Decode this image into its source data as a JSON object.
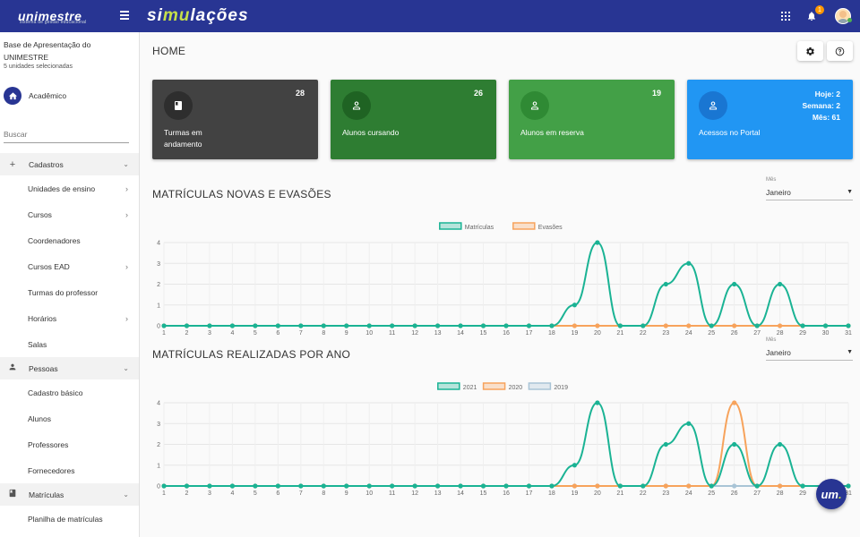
{
  "topbar": {
    "logo_text": "unimestre",
    "logo_sub": "sistema de gestão educacional",
    "brand_parts": [
      "si",
      "mu",
      "lações"
    ],
    "notification_count": "1"
  },
  "sidebar": {
    "org_name": "Base de Apresentação do UNIMESTRE",
    "units": "5 unidades selecionadas",
    "academic_label": "Acadêmico",
    "search_placeholder": "Buscar",
    "groups": [
      {
        "label": "Cadastros",
        "icon": "plus-icon",
        "items": [
          {
            "label": "Unidades de ensino",
            "has_children": true
          },
          {
            "label": "Cursos",
            "has_children": true
          },
          {
            "label": "Coordenadores",
            "has_children": false
          },
          {
            "label": "Cursos EAD",
            "has_children": true
          },
          {
            "label": "Turmas do professor",
            "has_children": false
          },
          {
            "label": "Horários",
            "has_children": true
          },
          {
            "label": "Salas",
            "has_children": false
          }
        ]
      },
      {
        "label": "Pessoas",
        "icon": "person-icon",
        "items": [
          {
            "label": "Cadastro básico",
            "has_children": false
          },
          {
            "label": "Alunos",
            "has_children": false
          },
          {
            "label": "Professores",
            "has_children": false
          },
          {
            "label": "Fornecedores",
            "has_children": false
          }
        ]
      },
      {
        "label": "Matrículas",
        "icon": "book-icon",
        "items": [
          {
            "label": "Planilha de matrículas",
            "has_children": false
          }
        ]
      }
    ]
  },
  "main": {
    "title": "HOME",
    "cards": [
      {
        "label": "Turmas em andamento",
        "count": "28",
        "color": "#424242",
        "icon_bg": "#2e2e2e",
        "icon": "book-icon"
      },
      {
        "label": "Alunos cursando",
        "count": "26",
        "color": "#2e7d32",
        "icon_bg": "#1f6323",
        "icon": "person-icon"
      },
      {
        "label": "Alunos em reserva",
        "count": "19",
        "color": "#43a047",
        "icon_bg": "#2f8a34",
        "icon": "person-icon"
      },
      {
        "label": "Acessos no Portal",
        "color": "#2196f3",
        "icon_bg": "#1976d2",
        "icon": "person-icon",
        "stats": [
          "Hoje: 2",
          "Semana: 2",
          "Mês: 61"
        ]
      }
    ],
    "section1": {
      "title": "MATRÍCULAS NOVAS E EVASÕES",
      "month_label": "Mês",
      "month_value": "Janeiro"
    },
    "section2": {
      "title": "MATRÍCULAS REALIZADAS POR ANO",
      "month_label": "Mês",
      "month_value": "Janeiro"
    }
  },
  "chart_data": [
    {
      "type": "line",
      "x": [
        1,
        2,
        3,
        4,
        5,
        6,
        7,
        8,
        9,
        10,
        11,
        12,
        13,
        14,
        15,
        16,
        17,
        18,
        19,
        20,
        21,
        22,
        23,
        24,
        25,
        26,
        27,
        28,
        29,
        30,
        31
      ],
      "ylim": [
        0,
        4
      ],
      "yticks": [
        0,
        1,
        2,
        3,
        4
      ],
      "grid": true,
      "legend": "top-center",
      "series": [
        {
          "name": "Matrículas",
          "color": "#1ab394",
          "values": [
            0,
            0,
            0,
            0,
            0,
            0,
            0,
            0,
            0,
            0,
            0,
            0,
            0,
            0,
            0,
            0,
            0,
            0,
            1,
            4,
            0,
            0,
            2,
            3,
            0,
            2,
            0,
            2,
            0,
            0,
            0
          ]
        },
        {
          "name": "Evasões",
          "color": "#f7a35c",
          "values": [
            0,
            0,
            0,
            0,
            0,
            0,
            0,
            0,
            0,
            0,
            0,
            0,
            0,
            0,
            0,
            0,
            0,
            0,
            0,
            0,
            0,
            0,
            0,
            0,
            0,
            0,
            0,
            0,
            0,
            0,
            0
          ]
        }
      ]
    },
    {
      "type": "line",
      "x": [
        1,
        2,
        3,
        4,
        5,
        6,
        7,
        8,
        9,
        10,
        11,
        12,
        13,
        14,
        15,
        16,
        17,
        18,
        19,
        20,
        21,
        22,
        23,
        24,
        25,
        26,
        27,
        28,
        29,
        30,
        31
      ],
      "ylim": [
        0,
        4
      ],
      "yticks": [
        0,
        1,
        2,
        3,
        4
      ],
      "grid": true,
      "legend": "top-center",
      "series": [
        {
          "name": "2021",
          "color": "#1ab394",
          "values": [
            0,
            0,
            0,
            0,
            0,
            0,
            0,
            0,
            0,
            0,
            0,
            0,
            0,
            0,
            0,
            0,
            0,
            0,
            1,
            4,
            0,
            0,
            2,
            3,
            0,
            2,
            0,
            2,
            0,
            0,
            0
          ]
        },
        {
          "name": "2020",
          "color": "#f7a35c",
          "values": [
            0,
            0,
            0,
            0,
            0,
            0,
            0,
            0,
            0,
            0,
            0,
            0,
            0,
            0,
            0,
            0,
            0,
            0,
            0,
            0,
            0,
            0,
            0,
            0,
            0,
            4,
            0,
            0,
            0,
            0,
            0
          ]
        },
        {
          "name": "2019",
          "color": "#a9c4d6",
          "values": [
            0,
            0,
            0,
            0,
            0,
            0,
            0,
            0,
            0,
            0,
            0,
            0,
            0,
            0,
            0,
            0,
            0,
            0,
            0,
            0,
            0,
            0,
            0,
            0,
            0,
            0,
            0,
            0,
            0,
            0,
            0
          ]
        }
      ]
    }
  ],
  "fab": {
    "text": "um",
    "dot": "."
  }
}
